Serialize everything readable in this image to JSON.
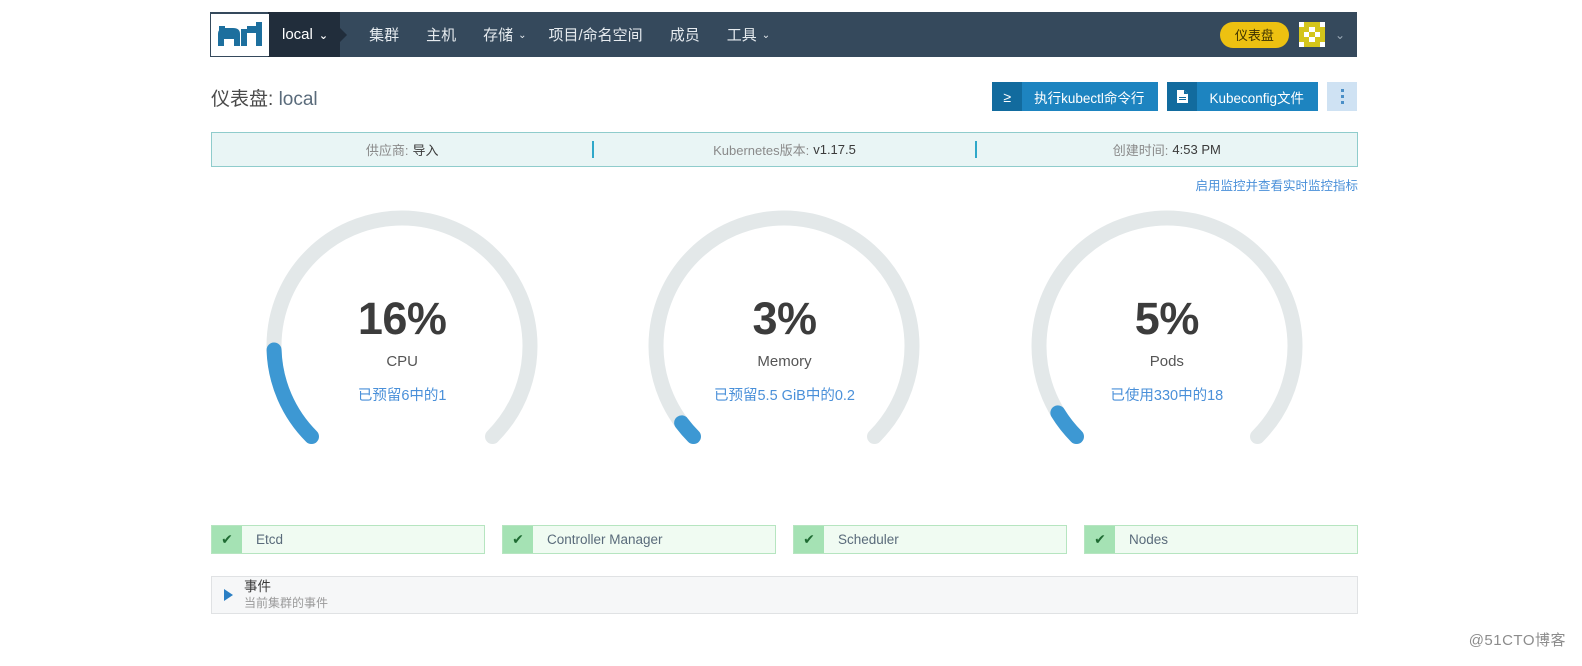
{
  "navbar": {
    "logo_icon": "rancher-cow-logo",
    "cluster_selector": {
      "label": "local",
      "caret": "⌄"
    },
    "items": [
      {
        "label": "集群",
        "caret": "",
        "name": "nav-item-clusters"
      },
      {
        "label": "主机",
        "caret": "",
        "name": "nav-item-hosts"
      },
      {
        "label": "存储",
        "caret": "⌄",
        "name": "nav-item-storage"
      },
      {
        "label": "项目/命名空间",
        "caret": "",
        "name": "nav-item-projects-namespaces"
      },
      {
        "label": "成员",
        "caret": "",
        "name": "nav-item-members"
      },
      {
        "label": "工具",
        "caret": "⌄",
        "name": "nav-item-tools"
      }
    ],
    "badge": "仪表盘",
    "avatar_caret": "⌄",
    "colors": {
      "bar": "#35495C",
      "cluster_pill": "#212D3B",
      "badge": "#EDC111",
      "avatar": "#D4C51B"
    }
  },
  "header": {
    "title_prefix": "仪表盘:",
    "title_value": "local",
    "buttons": [
      {
        "icon": "≥",
        "icon_name": "terminal-prompt-icon",
        "label": "执行kubectl命令行",
        "name": "run-kubectl-button"
      },
      {
        "icon": "὜e",
        "icon_name": "file-document-icon",
        "label": "Kubeconfig文件",
        "name": "kubeconfig-file-button"
      }
    ],
    "overflow_menu": "kebab-menu-icon"
  },
  "info_bar": {
    "cells": [
      {
        "label": "供应商:",
        "value": "导入",
        "name": "info-provider"
      },
      {
        "label": "Kubernetes版本:",
        "value": "v1.17.5",
        "name": "info-kubernetes-version"
      },
      {
        "label": "创建时间:",
        "value": "4:53 PM",
        "name": "info-created-time"
      }
    ]
  },
  "monitoring_link": "启用监控并查看实时监控指标",
  "chart_data": {
    "type": "gauge",
    "title": "Cluster resource utilization gauges",
    "arc_color": "#3D98D3",
    "track_color": "#E3E8E9",
    "gauges": [
      {
        "percent": 16,
        "percent_text": "16%",
        "label": "CPU",
        "sub": "已预留6中的1",
        "used": 1,
        "total": 6,
        "unit": "cores",
        "name": "gauge-cpu"
      },
      {
        "percent": 3,
        "percent_text": "3%",
        "label": "Memory",
        "sub": "已预留5.5 GiB中的0.2",
        "used": 0.2,
        "total": 5.5,
        "unit": "GiB",
        "name": "gauge-memory"
      },
      {
        "percent": 5,
        "percent_text": "5%",
        "label": "Pods",
        "sub": "已使用330中的18",
        "used": 18,
        "total": 330,
        "unit": "pods",
        "name": "gauge-pods"
      }
    ]
  },
  "components": {
    "check_icon": "✔",
    "items": [
      {
        "name": "status-etcd",
        "label": "Etcd",
        "state": "healthy"
      },
      {
        "name": "status-controller-manager",
        "label": "Controller Manager",
        "state": "healthy"
      },
      {
        "name": "status-scheduler",
        "label": "Scheduler",
        "state": "healthy"
      },
      {
        "name": "status-nodes",
        "label": "Nodes",
        "state": "healthy"
      }
    ],
    "colors": {
      "bg": "#F0FBF2",
      "check_bg": "#A5E2B4",
      "border": "#B6E5C0"
    }
  },
  "events": {
    "title": "事件",
    "subtitle": "当前集群的事件",
    "expanded": false
  },
  "watermark": "@51CTO博客"
}
